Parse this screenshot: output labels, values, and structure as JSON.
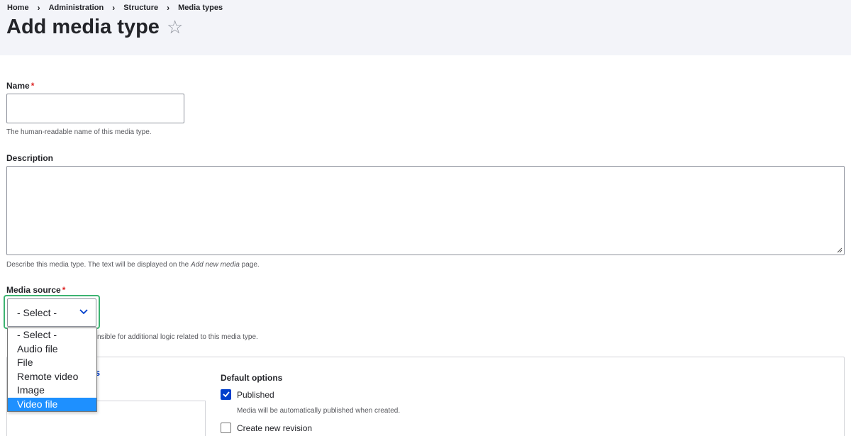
{
  "breadcrumb": [
    "Home",
    "Administration",
    "Structure",
    "Media types"
  ],
  "breadcrumb_sep": "›",
  "page": {
    "title": "Add media type",
    "star_glyph": "☆"
  },
  "form": {
    "name": {
      "label": "Name",
      "required_mark": "*",
      "value": "",
      "help": "The human-readable name of this media type."
    },
    "description": {
      "label": "Description",
      "value": "",
      "help_pre": "Describe this media type. The text will be displayed on the ",
      "help_em": "Add new media",
      "help_post": " page."
    },
    "media_source": {
      "label": "Media source",
      "required_mark": "*",
      "selected": "- Select -",
      "help_visible": "nsible for additional logic related to this media type.",
      "options": [
        "- Select -",
        "Audio file",
        "File",
        "Remote video",
        "Image",
        "Video file"
      ],
      "highlighted_option": "Video file"
    }
  },
  "vertical_tabs": {
    "partial_title": "ons"
  },
  "default_options": {
    "title": "Default options",
    "published": {
      "label": "Published",
      "checked": true,
      "help": "Media will be automatically published when created."
    },
    "new_revision": {
      "label": "Create new revision",
      "checked": false
    }
  },
  "colors": {
    "header_bg": "#f3f4f9",
    "focus_ring": "#3cb371",
    "accent": "#003ecc",
    "option_highlight": "#1e90ff",
    "required": "#dc2323"
  }
}
